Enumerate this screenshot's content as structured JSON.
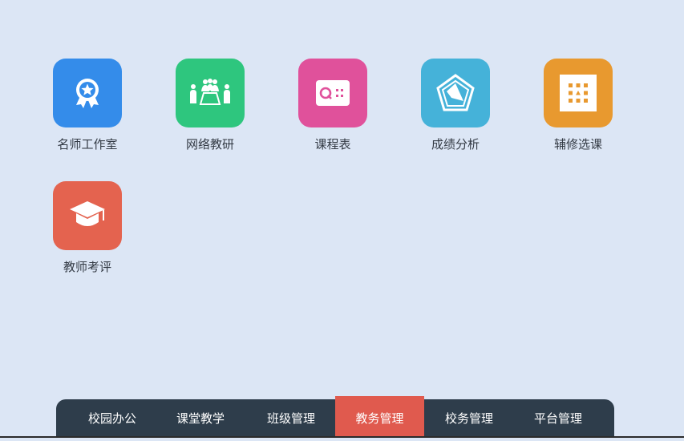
{
  "apps": [
    {
      "label": "名师工作室",
      "icon": "award-ribbon-icon",
      "color": "#348cea"
    },
    {
      "label": "网络教研",
      "icon": "meeting-table-icon",
      "color": "#2ec67e"
    },
    {
      "label": "课程表",
      "icon": "timetable-icon",
      "color": "#e0519b"
    },
    {
      "label": "成绩分析",
      "icon": "radar-chart-icon",
      "color": "#45b2d9"
    },
    {
      "label": "辅修选课",
      "icon": "grid-select-icon",
      "color": "#e8992f"
    },
    {
      "label": "教师考评",
      "icon": "graduation-cap-icon",
      "color": "#e4634f"
    }
  ],
  "taskbar": {
    "tabs": [
      {
        "label": "校园办公"
      },
      {
        "label": "课堂教学"
      },
      {
        "label": "班级管理"
      },
      {
        "label": "教务管理",
        "active": true
      },
      {
        "label": "校务管理"
      },
      {
        "label": "平台管理"
      }
    ],
    "background_color": "#2e3d4b",
    "active_color": "#e05a4e"
  },
  "background_color": "#dce6f5"
}
